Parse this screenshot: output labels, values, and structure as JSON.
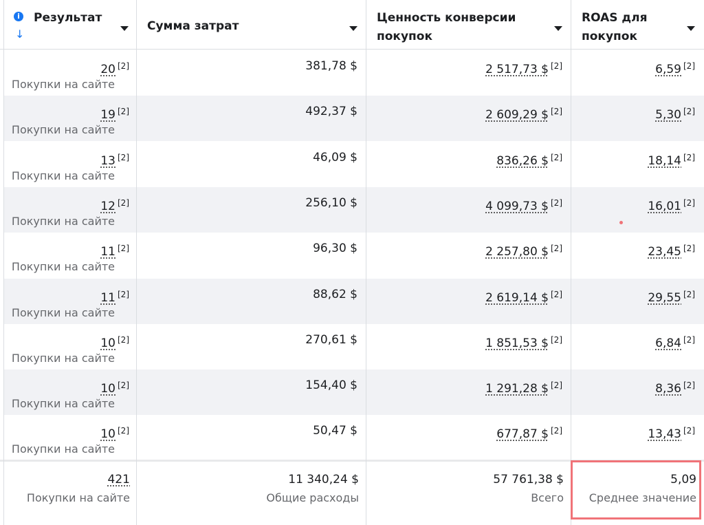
{
  "headers": {
    "result": "Результат",
    "spend": "Сумма затрат",
    "conv_value_line1": "Ценность конверсии",
    "conv_value_line2": "покупок",
    "roas_line1": "ROAS для",
    "roas_line2": "покупок"
  },
  "icons": {
    "info": "info-icon",
    "sort": "sort-down-arrow-icon",
    "caret": "caret-down-icon"
  },
  "colors": {
    "accent": "#1877f2",
    "highlight": "#f07378",
    "alt_row": "#f1f2f5",
    "muted": "#65676b"
  },
  "rows": [
    {
      "result": "20",
      "result_sub": "Покупки на сайте",
      "spend": "381,78 $",
      "conv_value": "2 517,73 $",
      "roas": "6,59",
      "note": "[2]"
    },
    {
      "result": "19",
      "result_sub": "Покупки на сайте",
      "spend": "492,37 $",
      "conv_value": "2 609,29 $",
      "roas": "5,30",
      "note": "[2]"
    },
    {
      "result": "13",
      "result_sub": "Покупки на сайте",
      "spend": "46,09 $",
      "conv_value": "836,26 $",
      "roas": "18,14",
      "note": "[2]"
    },
    {
      "result": "12",
      "result_sub": "Покупки на сайте",
      "spend": "256,10 $",
      "conv_value": "4 099,73 $",
      "roas": "16,01",
      "note": "[2]"
    },
    {
      "result": "11",
      "result_sub": "Покупки на сайте",
      "spend": "96,30 $",
      "conv_value": "2 257,80 $",
      "roas": "23,45",
      "note": "[2]"
    },
    {
      "result": "11",
      "result_sub": "Покупки на сайте",
      "spend": "88,62 $",
      "conv_value": "2 619,14 $",
      "roas": "29,55",
      "note": "[2]"
    },
    {
      "result": "10",
      "result_sub": "Покупки на сайте",
      "spend": "270,61 $",
      "conv_value": "1 851,53 $",
      "roas": "6,84",
      "note": "[2]"
    },
    {
      "result": "10",
      "result_sub": "Покупки на сайте",
      "spend": "154,40 $",
      "conv_value": "1 291,28 $",
      "roas": "8,36",
      "note": "[2]"
    },
    {
      "result": "10",
      "result_sub": "Покупки на сайте",
      "spend": "50,47 $",
      "conv_value": "677,87 $",
      "roas": "13,43",
      "note": "[2]"
    }
  ],
  "totals": {
    "result": "421",
    "result_sub": "Покупки на сайте",
    "spend": "11 340,24 $",
    "spend_sub": "Общие расходы",
    "conv_value": "57 761,38 $",
    "conv_value_sub": "Всего",
    "roas": "5,09",
    "roas_sub": "Среднее значение"
  }
}
